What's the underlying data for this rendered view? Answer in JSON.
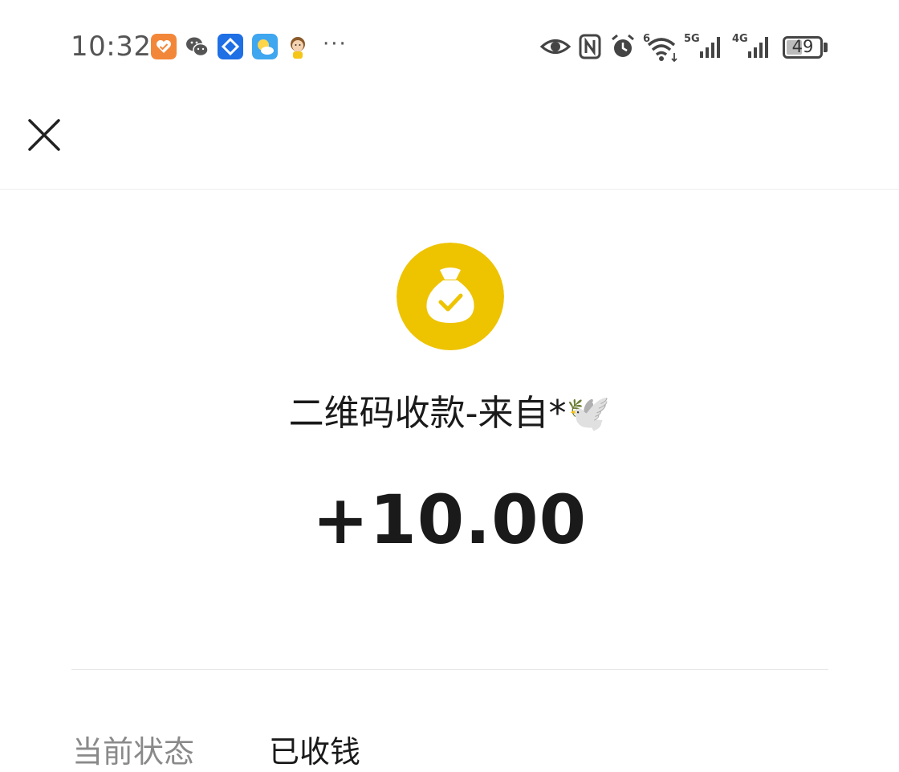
{
  "status_bar": {
    "time": "10:32",
    "more": "···",
    "wifi_label": "6",
    "signal1_label": "5G",
    "signal2_label": "4G",
    "battery": "49",
    "battery_level": 0.49
  },
  "header": {
    "close_icon": "close-icon"
  },
  "transaction": {
    "icon": "money-bag-check-icon",
    "icon_color": "#EEC300",
    "title": "二维码收款-来自*🕊️",
    "amount": "+10.00"
  },
  "details": [
    {
      "label": "当前状态",
      "value": "已收钱"
    }
  ]
}
